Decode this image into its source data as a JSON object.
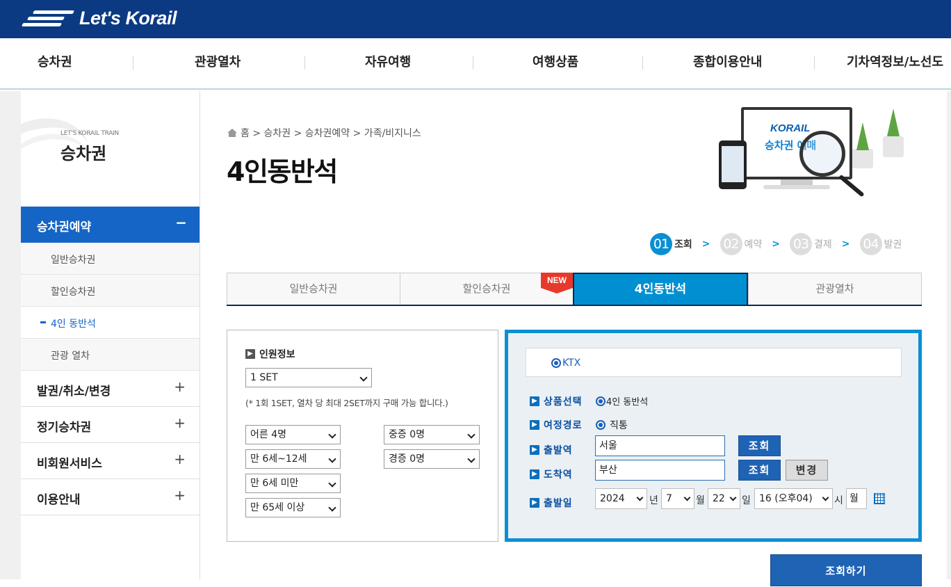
{
  "brand": {
    "logo_text": "Let's Korail"
  },
  "gnb": [
    "승차권",
    "관광열차",
    "자유여행",
    "여행상품",
    "종합이용안내",
    "기차역정보/노선도"
  ],
  "sidebar": {
    "subtitle": "LET'S KORAIL TRAIN",
    "title": "승차권",
    "active_menu": {
      "label": "승차권예약",
      "sign": "−"
    },
    "submenu": [
      "일반승차권",
      "할인승차권",
      "4인 동반석",
      "관광 열차"
    ],
    "current_submenu": "4인 동반석",
    "menus": [
      {
        "label": "발권/취소/변경",
        "sign": "+"
      },
      {
        "label": "정기승차권",
        "sign": "+"
      },
      {
        "label": "비회원서비스",
        "sign": "+"
      },
      {
        "label": "이용안내",
        "sign": "+"
      }
    ]
  },
  "breadcrumb": {
    "text": "홈 > 승차권 > 승차권예약 > 가족/비지니스"
  },
  "page_title": "4인동반석",
  "illustration": {
    "brand": "KORAIL",
    "caption": "승차권 예매"
  },
  "steps": [
    {
      "num": "01",
      "label": "조회",
      "active": true
    },
    {
      "num": "02",
      "label": "예약",
      "active": false
    },
    {
      "num": "03",
      "label": "결제",
      "active": false
    },
    {
      "num": "04",
      "label": "발권",
      "active": false
    }
  ],
  "step_arrow": ">",
  "tabs": [
    "일반승차권",
    "할인승차권",
    "4인동반석",
    "관광열차"
  ],
  "active_tab": "4인동반석",
  "new_badge": "NEW",
  "passenger": {
    "title": "인원정보",
    "set_value": "1 SET",
    "note": "(* 1회 1SET, 열차 당 최대 2SET까지 구매 가능 합니다.)",
    "adult": "어른 4명",
    "child": "만 6세~12세",
    "infant": "만 6세 미만",
    "senior": "만 65세 이상",
    "severe": "중증 0명",
    "mild": "경증 0명"
  },
  "search": {
    "train_option": "KTX",
    "product_label": "상품선택",
    "product_value": "4인 동반석",
    "route_label": "여정경로",
    "route_value": "직통",
    "dep_label": "출발역",
    "dep_value": "서울",
    "arr_label": "도착역",
    "arr_value": "부산",
    "lookup_btn": "조회",
    "change_btn": "변경",
    "date_label": "출발일",
    "year": "2024",
    "year_unit": "년",
    "month": "7",
    "month_unit": "월",
    "day": "22",
    "day_unit": "일",
    "hour": "16 (오후04)",
    "hour_unit": "시",
    "weekday": "월"
  },
  "submit_label": "조회하기",
  "colors": {
    "header": "#0b3a83",
    "accent": "#0090d2",
    "active_menu": "#1565c6",
    "new_badge": "#e53a2b"
  }
}
